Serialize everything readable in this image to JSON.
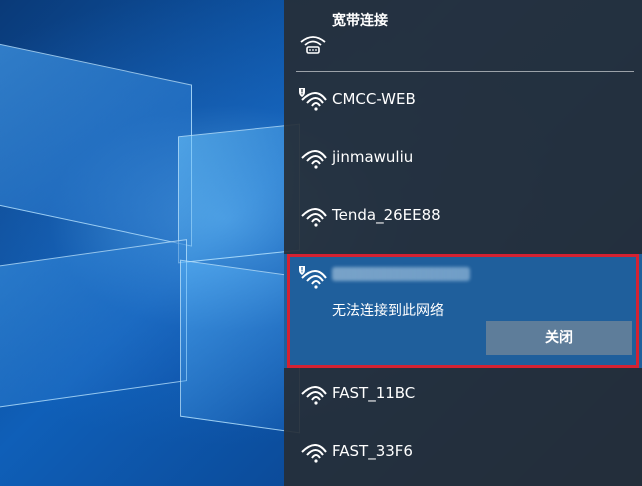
{
  "flyout": {
    "broadband": {
      "label": "宽带连接",
      "icon": "dial-up-icon"
    },
    "networks": [
      {
        "ssid": "CMCC-WEB",
        "secured": false,
        "icon": "wifi-warning-icon"
      },
      {
        "ssid": "jinmawuliu",
        "secured": true,
        "icon": "wifi-icon"
      },
      {
        "ssid": "Tenda_26EE88",
        "secured": true,
        "icon": "wifi-icon"
      }
    ],
    "selected": {
      "status": "无法连接到此网络",
      "close_label": "关闭",
      "icon": "wifi-warning-icon"
    },
    "networks_after": [
      {
        "ssid": "FAST_11BC",
        "icon": "wifi-icon"
      },
      {
        "ssid": "FAST_33F6",
        "icon": "wifi-icon"
      }
    ]
  },
  "colors": {
    "highlight_border": "#d42232",
    "selected_bg": "#1f5f9c",
    "flyout_bg": "#262e38",
    "button_bg": "#5e7d9a"
  }
}
